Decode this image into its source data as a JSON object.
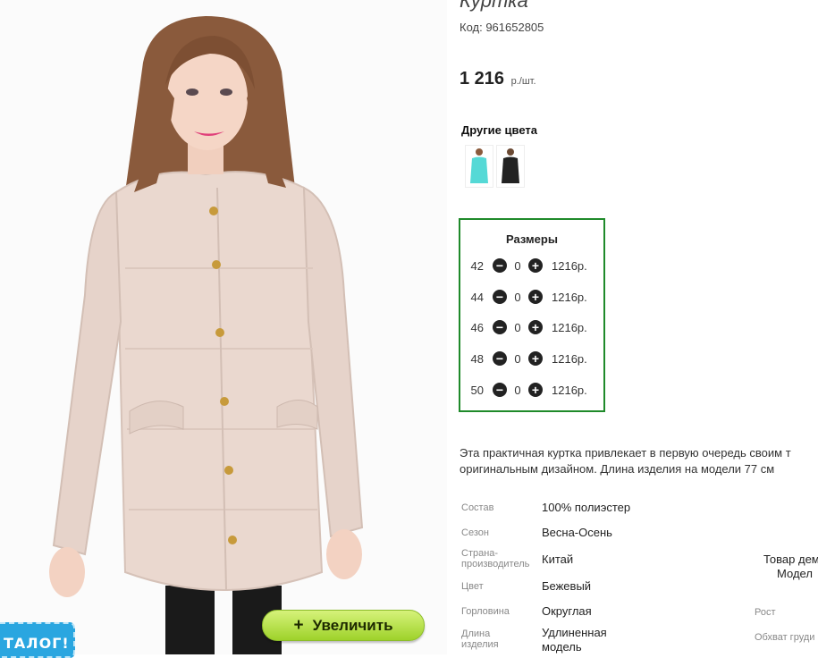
{
  "product": {
    "title": "Куртка",
    "code": "Код: 961652805",
    "price": "1 216",
    "price_unit": "р./шт."
  },
  "other_colors": {
    "heading": "Другие цвета",
    "swatches": [
      {
        "name": "turquoise",
        "color": "#55d9d6"
      },
      {
        "name": "black",
        "color": "#222222"
      }
    ]
  },
  "sizes": {
    "heading": "Размеры",
    "rows": [
      {
        "size": "42",
        "qty": "0",
        "price": "1216р."
      },
      {
        "size": "44",
        "qty": "0",
        "price": "1216р."
      },
      {
        "size": "46",
        "qty": "0",
        "price": "1216р."
      },
      {
        "size": "48",
        "qty": "0",
        "price": "1216р."
      },
      {
        "size": "50",
        "qty": "0",
        "price": "1216р."
      }
    ],
    "minus_symbol": "−",
    "plus_symbol": "+"
  },
  "description": {
    "line1": "Эта практичная куртка привлекает в первую очередь своим т",
    "line2": "оригинальным дизайном. Длина изделия на модели 77 см"
  },
  "specs": {
    "composition_label": "Состав",
    "composition": "100% полиэстер",
    "season_label": "Сезон",
    "season": "Весна-Осень",
    "country_label_1": "Страна-",
    "country_label_2": "производитель",
    "country": "Китай",
    "color_label": "Цвет",
    "color": "Бежевый",
    "neck_label": "Горловина",
    "neck": "Округлая",
    "length_label_1": "Длина",
    "length_label_2": "изделия",
    "length_1": "Удлиненная",
    "length_2": "модель",
    "model_line1": "Товар демо",
    "model_line2": "Модел",
    "height_label": "Рост",
    "chest_label": "Обхват груди"
  },
  "buttons": {
    "zoom_plus": "+",
    "zoom": "Увеличить",
    "catalog": "ТАЛОГ!"
  },
  "colors": {
    "accent_green": "#1f8a2a",
    "zoom_button": "#b3e04a",
    "catalog_tab": "#2aa6e0",
    "jacket": "#e9d9d0"
  }
}
